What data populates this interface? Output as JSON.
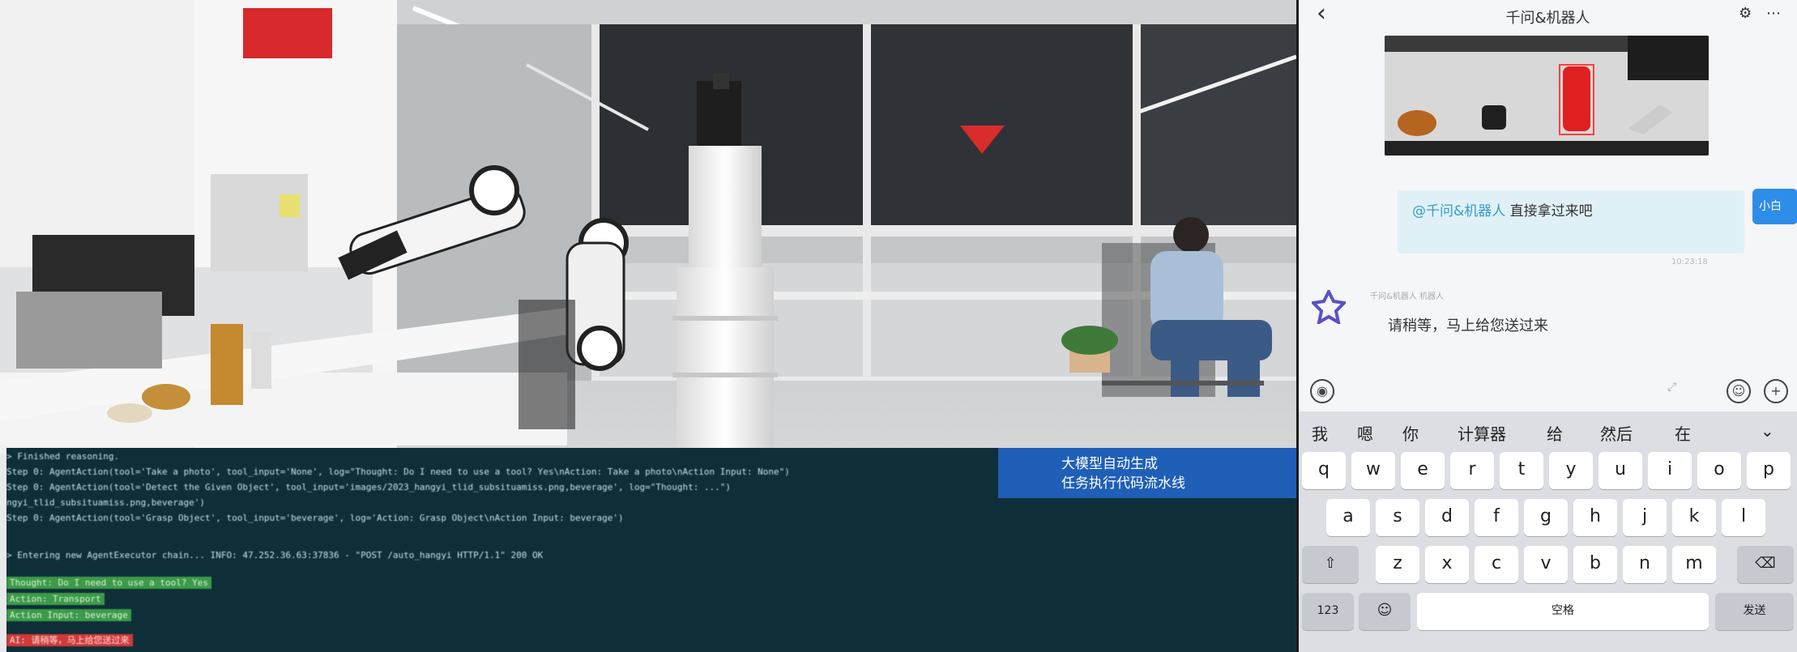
{
  "terminal": {
    "lines": [
      "> Finished reasoning.",
      "Step 0: AgentAction(tool='Take a photo', tool_input='None', log=\"Thought: Do I need to use a tool? Yes\\nAction: Take a photo\\nAction Input: None\")",
      "Step 0: AgentAction(tool='Detect the Given Object', tool_input='images/2023_hangyi_tlid_subsituamiss.png,beverage', log=\"Thought: ...\")",
      "ngyi_tlid_subsituamiss.png,beverage')",
      "Step 0: AgentAction(tool='Grasp Object', tool_input='beverage', log='Action: Grasp Object\\nAction Input: beverage')",
      "> Entering new AgentExecutor chain... INFO:     47.252.36.63:37836 - \"POST /auto_hangyi HTTP/1.1\" 200 OK"
    ],
    "green_lines": [
      "Thought: Do I need to use a tool? Yes",
      "Action: Transport",
      "Action Input: beverage"
    ],
    "red_line": "AI: 请稍等，马上给您送过来"
  },
  "caption": {
    "line1": "大模型自动生成",
    "line2": "任务执行代码流水线"
  },
  "phone": {
    "back_icon": "‹",
    "title": "千问&机器人",
    "top_icons": "⚙ ⋯",
    "me_mention": "@千问&机器人",
    "me_text": " 直接拿过来吧",
    "me_avatar_label": "小白",
    "me_time": "10:23:18",
    "bot_name": "千问&机器人  机器人",
    "bot_msg": "请稍等，马上给您送过来"
  },
  "keyboard": {
    "suggestions": [
      "我",
      "嗯",
      "你",
      "计算器",
      "给",
      "然后",
      "在"
    ],
    "row1": [
      "q",
      "w",
      "e",
      "r",
      "t",
      "y",
      "u",
      "i",
      "o",
      "p"
    ],
    "row2": [
      "a",
      "s",
      "d",
      "f",
      "g",
      "h",
      "j",
      "k",
      "l"
    ],
    "row3": [
      "z",
      "x",
      "c",
      "v",
      "b",
      "n",
      "m"
    ],
    "num_key": "123",
    "space_key": "空格",
    "send_key": "发送",
    "shift_icon": "⇧",
    "delete_icon": "⌫",
    "emoji_icon": "☺",
    "collapse_icon": "⌄"
  }
}
